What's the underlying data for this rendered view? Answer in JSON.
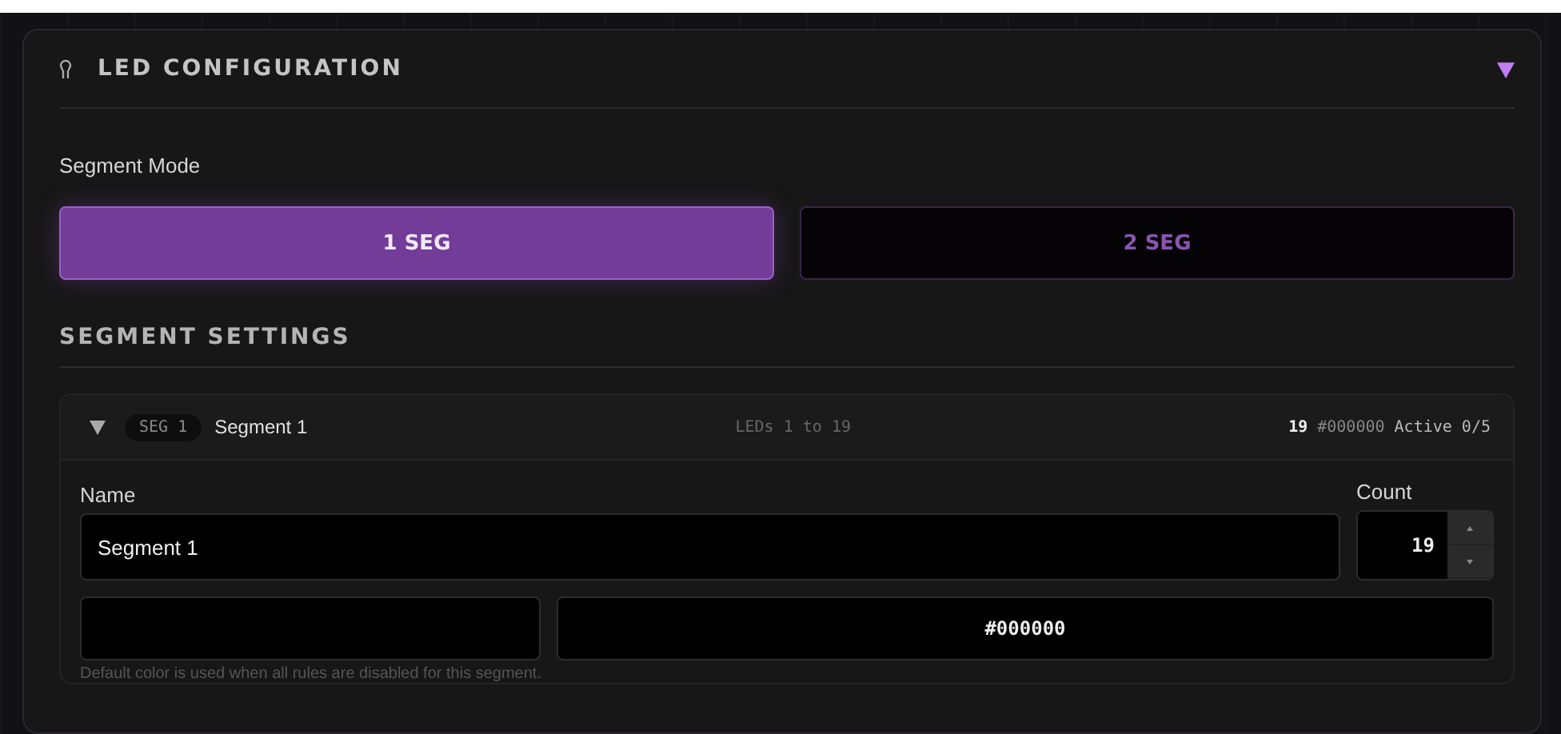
{
  "panel": {
    "title": "LED CONFIGURATION",
    "expanded": true
  },
  "segment_mode": {
    "label": "Segment Mode",
    "options": [
      {
        "label": "1 SEG",
        "selected": true
      },
      {
        "label": "2 SEG",
        "selected": false
      }
    ]
  },
  "segment_settings": {
    "title": "SEGMENT SETTINGS",
    "segments": [
      {
        "expanded": true,
        "badge": "SEG 1",
        "name": "Segment 1",
        "range": "LEDs 1 to 19",
        "count_summary": "19",
        "color_summary": "#000000",
        "active_summary": "Active 0/5",
        "name_label": "Name",
        "name_value": "Segment 1",
        "count_label": "Count",
        "count_value": "19",
        "color": "#000000",
        "color_value": "#000000",
        "hint": "Default color is used when all rules are disabled for this segment."
      }
    ]
  }
}
